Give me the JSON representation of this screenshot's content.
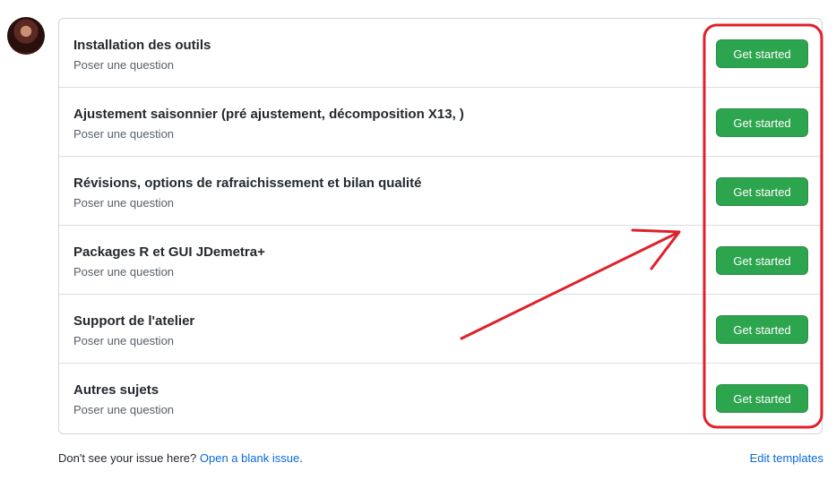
{
  "avatar": {
    "icon": "user-avatar"
  },
  "rows": [
    {
      "title": "Installation des outils",
      "subtitle": "Poser une question",
      "button": "Get started"
    },
    {
      "title": "Ajustement saisonnier (pré ajustement, décomposition X13, )",
      "subtitle": "Poser une question",
      "button": "Get started"
    },
    {
      "title": "Révisions, options de rafraichissement et bilan qualité",
      "subtitle": "Poser une question",
      "button": "Get started"
    },
    {
      "title": "Packages R et GUI JDemetra+",
      "subtitle": "Poser une question",
      "button": "Get started"
    },
    {
      "title": "Support de l'atelier",
      "subtitle": "Poser une question",
      "button": "Get started"
    },
    {
      "title": "Autres sujets",
      "subtitle": "Poser une question",
      "button": "Get started"
    }
  ],
  "footer": {
    "prompt": "Don't see your issue here?",
    "blank_issue_link": "Open a blank issue",
    "period": ".",
    "edit_templates": "Edit templates"
  },
  "annotation": {
    "color": "#e0202a"
  },
  "colors": {
    "button_green": "#2da44e",
    "link_blue": "#0969da"
  }
}
